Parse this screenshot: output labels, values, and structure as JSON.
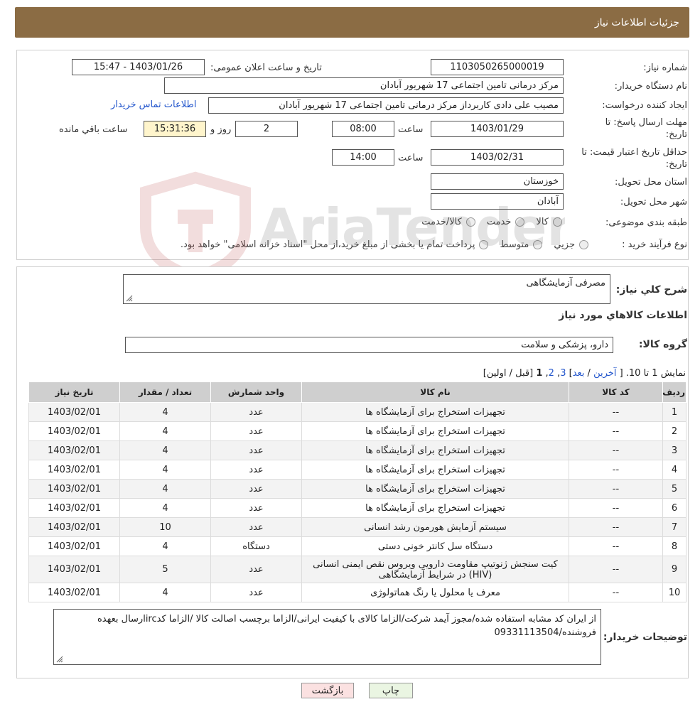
{
  "header": {
    "title": "جزئیات اطلاعات نیاز"
  },
  "info": {
    "need_number_label": "شماره نیاز:",
    "need_number": "1103050265000019",
    "announce_label": "تاریخ و ساعت اعلان عمومی:",
    "announce_value": "1403/01/26 - 15:47",
    "buyer_org_label": "نام دستگاه خریدار:",
    "buyer_org": "مرکز درمانی تامین اجتماعی 17 شهریور آبادان",
    "creator_label": "ایجاد کننده درخواست:",
    "creator": "مصیب علی دادی کاربرداز مرکز درمانی تامین اجتماعی 17 شهریور آبادان",
    "contact_link": "اطلاعات تماس خریدار",
    "reply_deadline_label": "مهلت ارسال پاسخ: تا تاریخ:",
    "reply_date": "1403/01/29",
    "time_label": "ساعت",
    "reply_time": "08:00",
    "days": "2",
    "days_label": "روز و",
    "remaining": "15:31:36",
    "remaining_label": "ساعت باقي مانده",
    "validity_label": "حداقل تاریخ اعتبار قیمت: تا تاریخ:",
    "validity_date": "1403/02/31",
    "validity_time": "14:00",
    "province_label": "استان محل تحویل:",
    "province": "خوزستان",
    "city_label": "شهر محل تحویل:",
    "city": "آبادان",
    "category_label": "طبقه بندی موضوعی:",
    "category_options": [
      "کالا",
      "خدمت",
      "کالا/خدمت"
    ],
    "purchase_label": "نوع فرآیند خرید :",
    "purchase_options": [
      "جزیي",
      "متوسط"
    ],
    "purchase_note": "پرداخت تمام یا بخشی از مبلغ خرید،از محل \"اسناد خزانه اسلامی\" خواهد بود."
  },
  "details": {
    "summary_label": "شرح کلي نياز:",
    "summary": "مصرفی آزمایشگاهی",
    "goods_title": "اطلاعات کالاهاي مورد نياز",
    "group_label": "گروه کالا:",
    "group": "دارو، پزشکی و سلامت",
    "pager": {
      "text_before": "نمایش 1 تا 10. [",
      "last": "آخرین",
      "next": "بعد",
      "p3": "3",
      "p2": "2",
      "p1": "1",
      "text_after": "[قبل / اولین]"
    },
    "table": {
      "headers": [
        "ردیف",
        "کد کالا",
        "نام کالا",
        "واحد شمارش",
        "تعداد / مقدار",
        "تاریخ نیاز"
      ],
      "rows": [
        [
          "1",
          "--",
          "تجهیزات استخراج برای آزمایشگاه ها",
          "عدد",
          "4",
          "1403/02/01"
        ],
        [
          "2",
          "--",
          "تجهیزات استخراج برای آزمایشگاه ها",
          "عدد",
          "4",
          "1403/02/01"
        ],
        [
          "3",
          "--",
          "تجهیزات استخراج برای آزمایشگاه ها",
          "عدد",
          "4",
          "1403/02/01"
        ],
        [
          "4",
          "--",
          "تجهیزات استخراج برای آزمایشگاه ها",
          "عدد",
          "4",
          "1403/02/01"
        ],
        [
          "5",
          "--",
          "تجهیزات استخراج برای آزمایشگاه ها",
          "عدد",
          "4",
          "1403/02/01"
        ],
        [
          "6",
          "--",
          "تجهیزات استخراج برای آزمایشگاه ها",
          "عدد",
          "4",
          "1403/02/01"
        ],
        [
          "7",
          "--",
          "سیستم آزمایش هورمون رشد انسانی",
          "عدد",
          "10",
          "1403/02/01"
        ],
        [
          "8",
          "--",
          "دستگاه سل کانتر خونی دستی",
          "دستگاه",
          "4",
          "1403/02/01"
        ],
        [
          "9",
          "--",
          "کیت سنجش ژنوتیپ مقاومت دارویی ویروس نقص ایمنی انسانی (HIV) در شرایط آزمایشگاهی",
          "عدد",
          "5",
          "1403/02/01"
        ],
        [
          "10",
          "--",
          "معرف یا محلول یا رنگ هماتولوژی",
          "عدد",
          "4",
          "1403/02/01"
        ]
      ]
    },
    "buyer_notes_label": "توضیحات خریدار:",
    "buyer_notes": "از ایران کد مشابه استفاده شده/مجوز آیمد شرکت/الزاما کالای با کیفیت ایرانی/الزاما برچسب اصالت کالا /الزاما کدircارسال بعهده فروشنده/09331113504"
  },
  "buttons": {
    "print": "چاپ",
    "back": "بازگشت"
  },
  "watermark": {
    "text": "AriaTender.neT"
  },
  "colors": {
    "header": "#8b6c44",
    "link": "#2255cc",
    "table_header": "#cfcfcf"
  }
}
